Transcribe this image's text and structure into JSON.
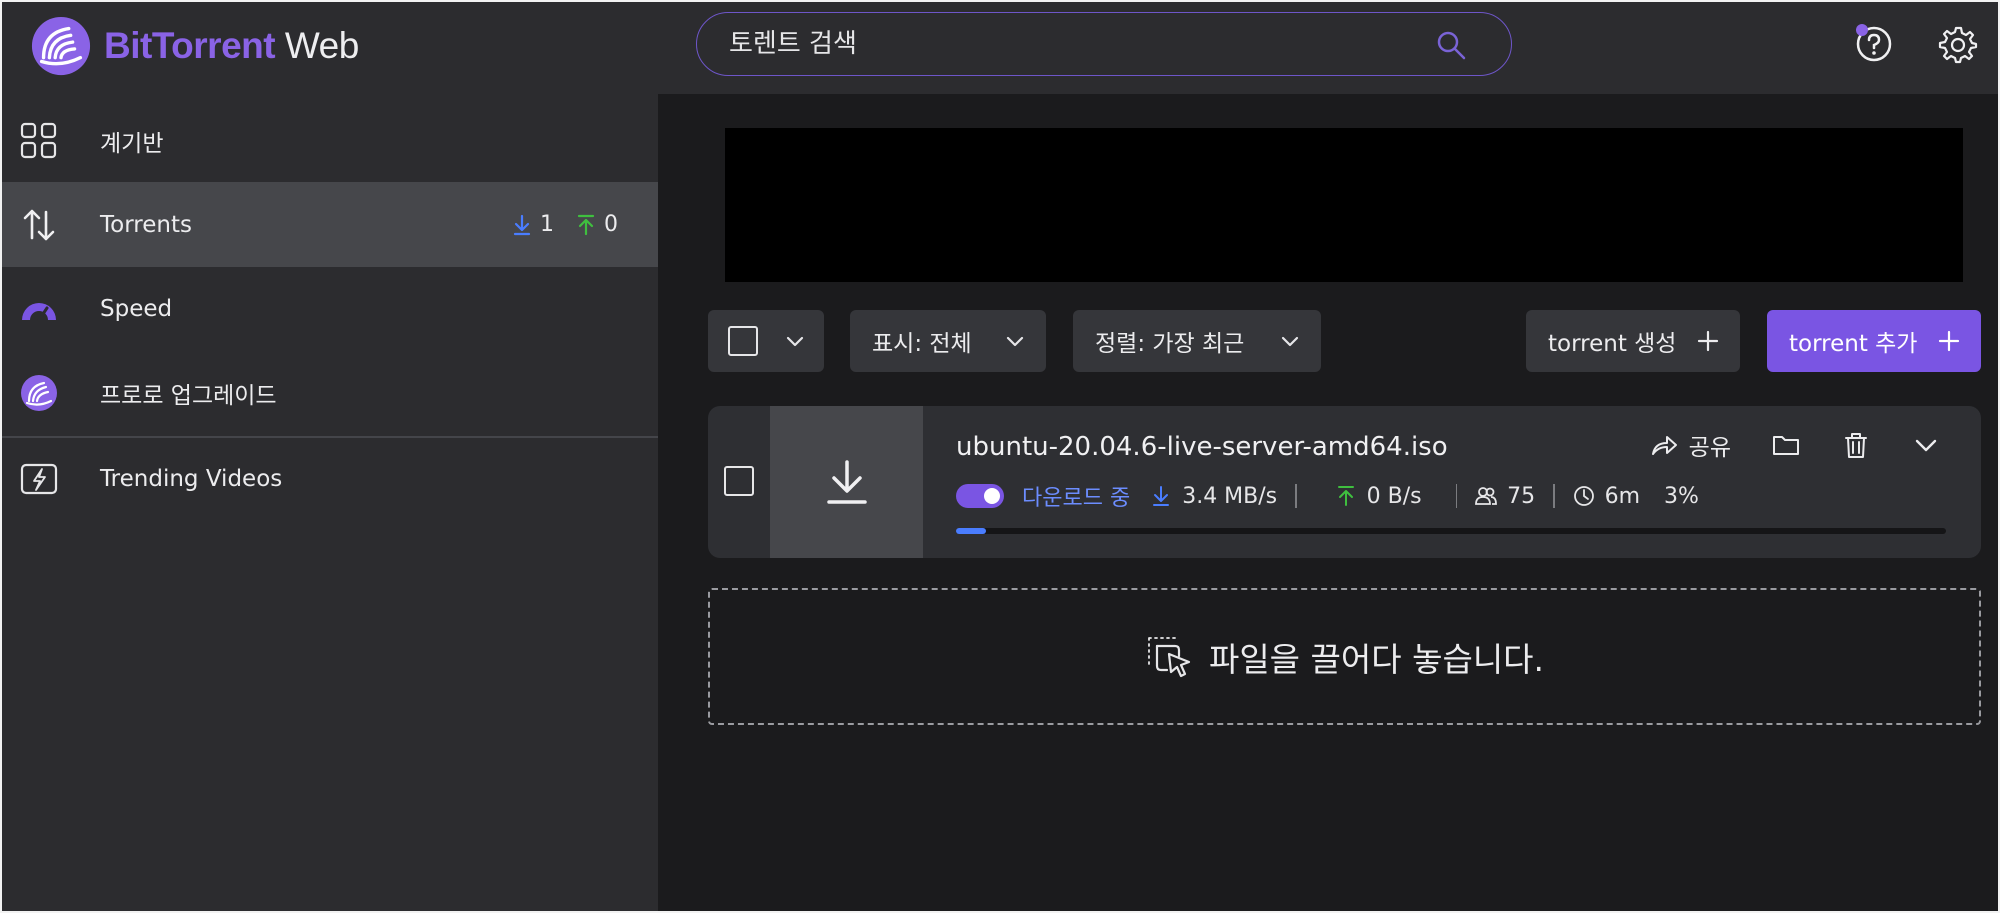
{
  "brand": {
    "name_bold": "BitTorrent",
    "name_light": " Web",
    "accent": "#8a63e6"
  },
  "search": {
    "placeholder": "토렌트 검색",
    "icon": "search-icon"
  },
  "header_icons": [
    "help-icon",
    "gear-icon"
  ],
  "sidebar": {
    "items": [
      {
        "label": "계기반",
        "icon": "dashboard-icon",
        "active": false
      },
      {
        "label": "Torrents",
        "icon": "transfer-arrows-icon",
        "active": true,
        "down_count": "1",
        "up_count": "0"
      },
      {
        "label": "Speed",
        "icon": "speedometer-icon",
        "active": false
      },
      {
        "label": "프로로 업그레이드",
        "icon": "bittorrent-pro-icon",
        "active": false
      },
      {
        "label": "Trending Videos",
        "icon": "lightning-screen-icon",
        "active": false
      }
    ]
  },
  "toolbar": {
    "filter_label": "표시: 전체",
    "sort_label": "정렬: 가장 최근",
    "create_label": "torrent 생성",
    "add_label": "torrent 추가"
  },
  "torrent": {
    "name": "ubuntu-20.04.6-live-server-amd64.iso",
    "share_label": "공유",
    "status": "다운로드 중",
    "down_speed": "3.4 MB/s",
    "up_speed": "0 B/s",
    "peers": "75",
    "eta": "6m",
    "percent": "3%",
    "progress": 0.03,
    "colors": {
      "status": "#6c8dff",
      "download_arrow": "#4a7dff",
      "upload_arrow": "#3fbf3f",
      "progress": "#4a7dff"
    }
  },
  "dropzone": {
    "text": "파일을 끌어다 놓습니다."
  }
}
